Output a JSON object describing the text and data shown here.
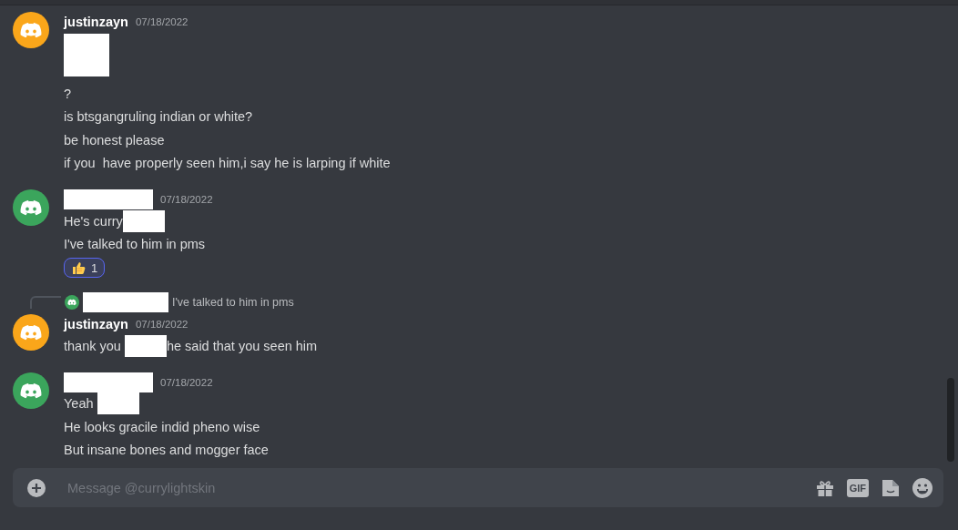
{
  "messages": [
    {
      "color": "#faa61a",
      "author": {
        "kind": "name",
        "text": "justinzayn"
      },
      "date": "07/18/2022",
      "lines": [
        {
          "kind": "image-redaction"
        },
        {
          "kind": "text",
          "segments": [
            {
              "kind": "text",
              "text": "?"
            }
          ]
        },
        {
          "kind": "text",
          "segments": [
            {
              "kind": "text",
              "text": "is btsgangruling indian or white?"
            }
          ]
        },
        {
          "kind": "text",
          "segments": [
            {
              "kind": "text",
              "text": "be honest please"
            }
          ]
        },
        {
          "kind": "text",
          "segments": [
            {
              "kind": "text",
              "text": "if you  have properly seen him,i say he is larping if white"
            }
          ]
        }
      ]
    },
    {
      "color": "#3ba55c",
      "author": {
        "kind": "redacted"
      },
      "date": "07/18/2022",
      "lines": [
        {
          "kind": "text",
          "segments": [
            {
              "kind": "text",
              "text": "He's curry"
            },
            {
              "kind": "redaction"
            }
          ]
        },
        {
          "kind": "text",
          "segments": [
            {
              "kind": "text",
              "text": "I've talked to him in pms"
            }
          ]
        }
      ],
      "reaction": {
        "count": "1",
        "selected": true
      }
    },
    {
      "color": "#faa61a",
      "author": {
        "kind": "name",
        "text": "justinzayn"
      },
      "date": "07/18/2022",
      "reply": {
        "color": "#3ba55c",
        "text": "I've talked to him in pms"
      },
      "lines": [
        {
          "kind": "text",
          "segments": [
            {
              "kind": "text",
              "text": "thank you "
            },
            {
              "kind": "redaction"
            },
            {
              "kind": "text",
              "text": "he said that you seen him"
            }
          ]
        }
      ]
    },
    {
      "color": "#3ba55c",
      "author": {
        "kind": "redacted"
      },
      "date": "07/18/2022",
      "lines": [
        {
          "kind": "text",
          "segments": [
            {
              "kind": "text",
              "text": "Yeah "
            },
            {
              "kind": "redaction"
            }
          ]
        },
        {
          "kind": "text",
          "segments": [
            {
              "kind": "text",
              "text": "He looks gracile indid pheno wise"
            }
          ]
        },
        {
          "kind": "text",
          "segments": [
            {
              "kind": "text",
              "text": "But insane bones and mogger face"
            }
          ]
        }
      ]
    }
  ],
  "composer": {
    "placeholder": "Message @currylightskin",
    "gif_label": "GIF"
  }
}
